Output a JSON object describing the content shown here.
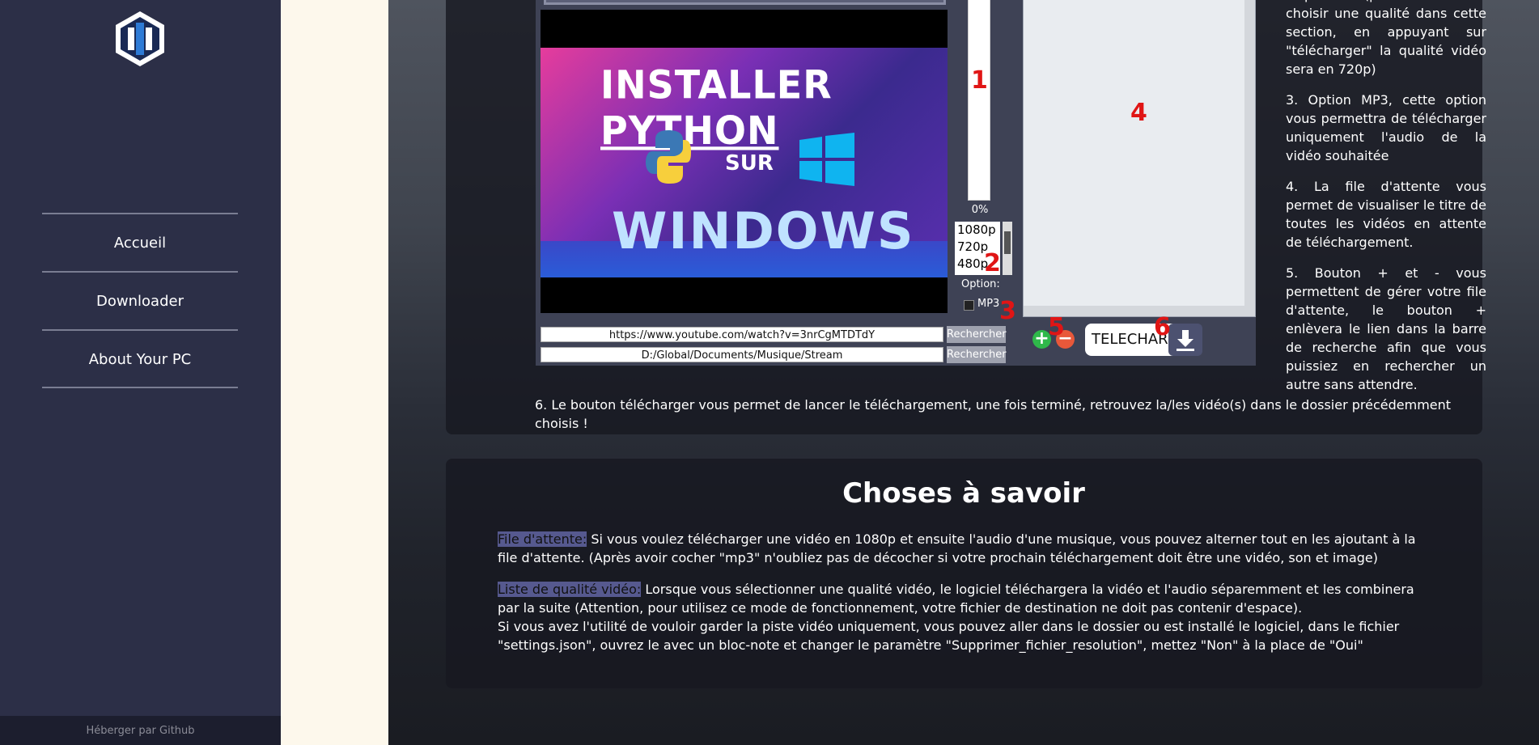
{
  "sidebar": {
    "nav": [
      "Accueil",
      "Downloader",
      "About Your PC"
    ],
    "footer": "Héberger par Github"
  },
  "app": {
    "thumbnail": {
      "line1_a": "INSTALLER",
      "line1_b": "PYTHON",
      "line2": "SUR",
      "line3": "WINDOWS"
    },
    "progress_percent": "0%",
    "quality_options": [
      "1080p",
      "720p",
      "480p"
    ],
    "option_label": "Option:",
    "mp3_label": "MP3",
    "url_value": "https://www.youtube.com/watch?v=3nrCgMTDTdY",
    "path_value": "D:/Global/Documents/Musique/Stream",
    "search_label": "Rechercher",
    "download_label": "TELECHARGER",
    "markers": [
      "1",
      "2",
      "3",
      "4",
      "5",
      "6"
    ]
  },
  "descriptions": {
    "item2_tail": "disponible (par défaut sans choisir une qualité dans cette section, en appuyant sur \"télécharger\" la qualité vidéo sera en 720p)",
    "item3": "3. Option MP3, cette option vous permettra de télécharger uniquement l'audio de la vidéo souhaitée",
    "item4": "4. La file d'attente vous permet de visualiser le titre de toutes les vidéos en attente de téléchargement.",
    "item5": "5. Bouton + et - vous permettent de gérer votre file d'attente, le bouton + enlèvera le lien dans la barre de recherche afin que vous puissiez en rechercher un autre sans attendre.",
    "item6": "6. Le bouton télécharger vous permet de lancer le téléchargement, une fois terminé, retrouvez la/les vidéo(s) dans le dossier précédemment choisis !"
  },
  "things_to_know": {
    "title": "Choses à savoir",
    "queue_label": "File d'attente:",
    "queue_text": " Si vous voulez télécharger une vidéo en 1080p et ensuite l'audio d'une musique, vous pouvez alterner tout en les ajoutant à la file d'attente. (Après avoir cocher \"mp3\" n'oubliez pas de décocher si votre prochain téléchargement doit être une vidéo, son et image)",
    "quality_label": "Liste de qualité vidéo:",
    "quality_text": " Lorsque vous sélectionner une qualité vidéo, le logiciel téléchargera la vidéo et l'audio séparemment et les combinera par la suite (Attention, pour utilisez ce mode de fonctionnement, votre fichier de destination ne doit pas contenir d'espace).",
    "quality_text2": "Si vous avez l'utilité de vouloir garder la piste vidéo uniquement, vous pouvez aller dans le dossier ou est installé le logiciel, dans le fichier \"settings.json\", ouvrez le avec un bloc-note et changer le paramètre \"Supprimer_fichier_resolution\", mettez \"Non\" à la place de \"Oui\""
  }
}
